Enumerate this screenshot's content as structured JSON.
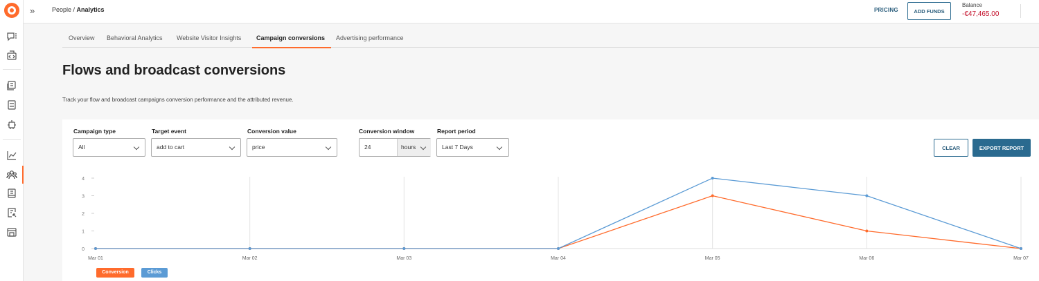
{
  "header": {
    "breadcrumb_parent": "People",
    "breadcrumb_sep": " / ",
    "breadcrumb_current": "Analytics",
    "pricing": "PRICING",
    "add_funds": "ADD FUNDS",
    "balance_label": "Balance",
    "balance_value": "-€47,465.00"
  },
  "tabs": [
    {
      "label": "Overview",
      "active": false
    },
    {
      "label": "Behavioral Analytics",
      "active": false
    },
    {
      "label": "Website Visitor Insights",
      "active": false
    },
    {
      "label": "Campaign conversions",
      "active": true
    },
    {
      "label": "Advertising performance",
      "active": false
    }
  ],
  "page": {
    "title": "Flows and broadcast conversions",
    "subtitle": "Track your flow and broadcast campaigns conversion performance and the attributed revenue."
  },
  "filters": {
    "campaign_type": {
      "label": "Campaign type",
      "value": "All"
    },
    "target_event": {
      "label": "Target event",
      "value": "add to cart"
    },
    "conversion_value": {
      "label": "Conversion value",
      "value": "price"
    },
    "conversion_window": {
      "label": "Conversion window",
      "value": "24",
      "unit": "hours"
    },
    "report_period": {
      "label": "Report period",
      "value": "Last 7 Days"
    }
  },
  "actions": {
    "clear": "CLEAR",
    "export": "EXPORT REPORT"
  },
  "colors": {
    "accent": "#ff6b2c",
    "primary": "#2a6a8f",
    "negative": "#c4102b",
    "clicks": "#5b9bd5",
    "conversion": "#ff6b2c"
  },
  "chart_data": {
    "type": "line",
    "title": "",
    "xlabel": "",
    "ylabel": "",
    "categories": [
      "Mar 01",
      "Mar 02",
      "Mar 03",
      "Mar 04",
      "Mar 05",
      "Mar 06",
      "Mar 07"
    ],
    "ylim": [
      0,
      4
    ],
    "yticks": [
      0,
      1,
      2,
      3,
      4
    ],
    "grid": "vertical",
    "legend": "bottom-left",
    "series": [
      {
        "name": "Conversion",
        "color": "#ff6b2c",
        "values": [
          0,
          0,
          0,
          0,
          3,
          1,
          0
        ]
      },
      {
        "name": "Clicks",
        "color": "#5b9bd5",
        "values": [
          0,
          0,
          0,
          0,
          4,
          3,
          0
        ]
      }
    ]
  }
}
